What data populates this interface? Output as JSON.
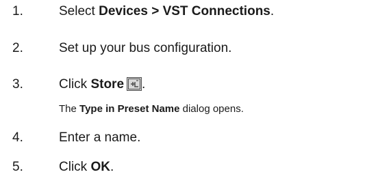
{
  "steps": [
    {
      "number": "1.",
      "prefix": "Select ",
      "bold": "Devices > VST Connections",
      "suffix": "."
    },
    {
      "number": "2.",
      "text": "Set up your bus configuration."
    },
    {
      "number": "3.",
      "prefix": "Click ",
      "bold": "Store",
      "suffix": ".",
      "icon": "store-preset-icon"
    },
    {
      "number": "4.",
      "text": "Enter a name."
    },
    {
      "number": "5.",
      "prefix": "Click ",
      "bold": "OK",
      "suffix": "."
    }
  ],
  "note": {
    "prefix": "The ",
    "bold": "Type in Preset Name",
    "suffix": " dialog opens."
  },
  "colors": {
    "text": "#1a1a1a",
    "icon_frame": "#4a4a4a",
    "icon_fill": "#d9d9d9"
  }
}
